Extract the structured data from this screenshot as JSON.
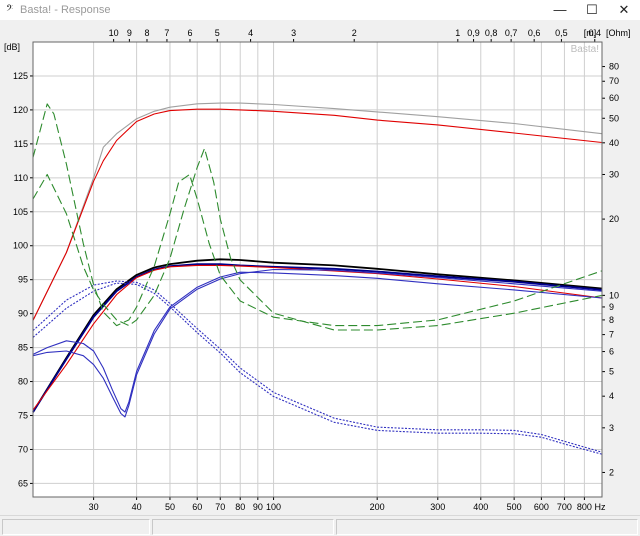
{
  "window": {
    "app_icon": "𝄢",
    "title": "Basta! - Response",
    "minimize_glyph": "—",
    "maximize_glyph": "☐",
    "close_glyph": "✕"
  },
  "chart_data": {
    "type": "line",
    "title": "",
    "watermark": "Basta!",
    "left_axis": {
      "label": "[dB]",
      "range": [
        63,
        130
      ],
      "ticks": [
        65,
        70,
        75,
        80,
        85,
        90,
        95,
        100,
        105,
        110,
        115,
        120,
        125
      ]
    },
    "bottom_axis": {
      "label": "Hz",
      "scale": "log",
      "range": [
        20,
        900
      ],
      "ticks": [
        30,
        40,
        50,
        60,
        70,
        80,
        90,
        100,
        200,
        300,
        400,
        500,
        600,
        700,
        800
      ]
    },
    "top_axis": {
      "label": "[m]",
      "ticks": [
        "10",
        "9",
        "8",
        "7",
        "6",
        "5",
        "4",
        "3",
        "2",
        "1",
        "0,9",
        "0,8",
        "0,7",
        "0,6",
        "0,5",
        "0,4"
      ]
    },
    "right_axis": {
      "label": "[Ohm]",
      "scale": "log",
      "range": [
        1.6,
        100
      ],
      "ticks": [
        2,
        3,
        4,
        5,
        6,
        7,
        8,
        9,
        10,
        20,
        30,
        40,
        50,
        60,
        70,
        80
      ]
    },
    "grid": true,
    "series": [
      {
        "color": "#a0a0a0",
        "style": "solid",
        "axis": "dB",
        "x": [
          20,
          25,
          30,
          32,
          35,
          40,
          45,
          50,
          60,
          70,
          80,
          100,
          150,
          200,
          300,
          500,
          900
        ],
        "y": [
          89,
          99,
          110,
          114.5,
          116.5,
          118.7,
          119.8,
          120.4,
          120.9,
          121,
          121,
          120.8,
          120.2,
          119.7,
          119,
          118,
          116.5
        ]
      },
      {
        "color": "#e00000",
        "style": "solid",
        "axis": "dB",
        "x": [
          20,
          25,
          30,
          32,
          35,
          40,
          45,
          50,
          60,
          70,
          80,
          100,
          150,
          200,
          300,
          500,
          900
        ],
        "y": [
          89,
          99,
          109.5,
          112.5,
          115.5,
          118.3,
          119.4,
          119.9,
          120.1,
          120.1,
          120,
          119.8,
          119.2,
          118.5,
          117.8,
          116.6,
          115.2
        ]
      },
      {
        "color": "#000000",
        "style": "solid",
        "axis": "dB",
        "x": [
          20,
          25,
          30,
          35,
          40,
          45,
          50,
          60,
          70,
          80,
          100,
          150,
          200,
          300,
          500,
          900
        ],
        "y": [
          75.5,
          83.5,
          89.8,
          93.6,
          95.7,
          96.8,
          97.3,
          97.8,
          98,
          97.9,
          97.5,
          97.1,
          96.6,
          95.8,
          94.9,
          93.7
        ]
      },
      {
        "color": "#00008b",
        "style": "solid",
        "axis": "dB",
        "x": [
          20,
          25,
          30,
          35,
          40,
          45,
          50,
          60,
          70,
          80,
          100,
          150,
          200,
          300,
          500,
          900
        ],
        "y": [
          75.5,
          83.3,
          89.5,
          93.3,
          95.4,
          96.5,
          97,
          97.3,
          97.3,
          97.1,
          96.9,
          96.6,
          96.2,
          95.5,
          94.7,
          93.5
        ]
      },
      {
        "color": "#e00000",
        "style": "solid",
        "axis": "dB",
        "x": [
          20,
          25,
          30,
          35,
          40,
          45,
          50,
          60,
          70,
          80,
          100,
          150,
          200,
          300,
          500,
          900
        ],
        "y": [
          75.8,
          82.5,
          88.5,
          92.8,
          95.3,
          96.4,
          96.9,
          97.1,
          97.1,
          97,
          96.8,
          96.3,
          95.9,
          95.1,
          94,
          92.3
        ]
      },
      {
        "color": "#3030c0",
        "style": "solid",
        "axis": "dB",
        "x": [
          20,
          22,
          25,
          28,
          30,
          32,
          34,
          36,
          37,
          38,
          40,
          45,
          50,
          60,
          70,
          80,
          100,
          150,
          200,
          300,
          500,
          900
        ],
        "y": [
          83.8,
          84.3,
          84.5,
          83.8,
          82.5,
          80.5,
          77.8,
          75.3,
          74.8,
          76.5,
          81,
          87,
          90.7,
          93.6,
          95.1,
          95.9,
          96.5,
          96.4,
          96,
          95.3,
          94.4,
          93.3
        ]
      },
      {
        "color": "#3030c0",
        "style": "solid",
        "axis": "dB",
        "x": [
          20,
          22,
          25,
          28,
          30,
          32,
          34,
          36,
          37,
          38,
          40,
          45,
          50,
          60,
          70,
          80,
          100,
          150,
          200,
          300,
          500,
          900
        ],
        "y": [
          84,
          85,
          86,
          85.6,
          84.5,
          82,
          78.8,
          76,
          75.5,
          77,
          81.5,
          87.5,
          91,
          93.9,
          95.4,
          96.1,
          96,
          95.6,
          95.2,
          94.4,
          93.5,
          92.3
        ]
      },
      {
        "color": "#3030c0",
        "style": "dotted",
        "axis": "dB",
        "x": [
          20,
          25,
          30,
          35,
          40,
          45,
          50,
          60,
          70,
          80,
          100,
          150,
          200,
          300,
          400,
          500,
          600,
          700,
          900
        ],
        "y": [
          86.5,
          90.8,
          93.3,
          94.5,
          94.3,
          93,
          91,
          87.2,
          84.2,
          81.3,
          77.8,
          74,
          72.8,
          72.4,
          72.4,
          72.3,
          71.8,
          70.8,
          69.3
        ]
      },
      {
        "color": "#3030c0",
        "style": "dotted",
        "axis": "dB",
        "x": [
          20,
          25,
          30,
          35,
          40,
          45,
          50,
          60,
          70,
          80,
          100,
          150,
          200,
          300,
          400,
          500,
          600,
          700,
          900
        ],
        "y": [
          87.5,
          92,
          94.2,
          94.8,
          94.6,
          93.5,
          91.5,
          87.8,
          84.8,
          82,
          78.4,
          74.6,
          73.3,
          72.9,
          72.9,
          72.8,
          72.2,
          71.2,
          69.6
        ]
      },
      {
        "color": "#2e8b2e",
        "style": "dashed",
        "axis": "Ohm",
        "x": [
          20,
          21,
          22,
          23,
          25,
          28,
          30,
          32,
          35,
          38,
          40,
          45,
          50,
          53,
          57,
          60,
          65,
          70,
          80,
          100,
          150,
          200,
          300,
          500,
          900
        ],
        "y": [
          35,
          45,
          57,
          52,
          33,
          16,
          11,
          8.6,
          7.6,
          8,
          9,
          13,
          21,
          28,
          30,
          24,
          16,
          12,
          9.5,
          8.2,
          7.6,
          7.6,
          8,
          9.5,
          12.5
        ]
      },
      {
        "color": "#2e8b2e",
        "style": "dashed",
        "axis": "Ohm",
        "x": [
          20,
          22,
          25,
          28,
          30,
          32,
          35,
          38,
          40,
          45,
          50,
          55,
          60,
          63,
          67,
          70,
          75,
          80,
          100,
          150,
          200,
          300,
          500,
          900
        ],
        "y": [
          24,
          30,
          21,
          13,
          10.5,
          9.2,
          8,
          7.6,
          8,
          10,
          14,
          22,
          32,
          38,
          28,
          20,
          14,
          11.5,
          8.5,
          7.3,
          7.3,
          7.6,
          8.5,
          10
        ]
      }
    ]
  }
}
